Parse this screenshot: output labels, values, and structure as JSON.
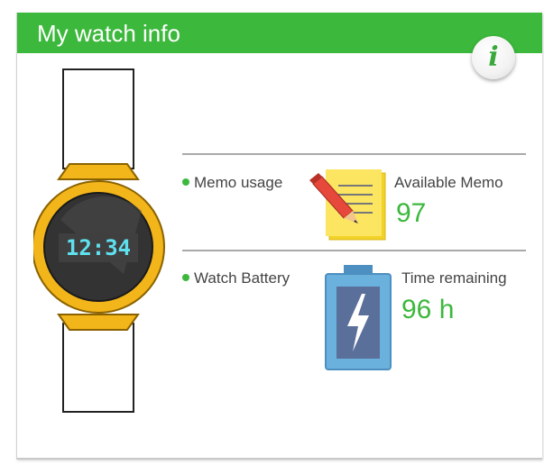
{
  "header": {
    "title": "My watch info",
    "info_icon": "info-icon",
    "info_glyph": "i"
  },
  "watch": {
    "display_time": "12:34",
    "icon": "smartwatch-icon"
  },
  "memo": {
    "section_label": "Memo usage",
    "icon": "memo-pencil-icon",
    "stat_label": "Available Memo",
    "stat_value": "97"
  },
  "battery": {
    "section_label": "Watch Battery",
    "icon": "battery-charging-icon",
    "stat_label": "Time remaining",
    "stat_value": "96 h"
  },
  "colors": {
    "accent_green": "#3cb83c",
    "watch_yellow": "#f2b51a",
    "battery_blue": "#5fa8d8"
  }
}
